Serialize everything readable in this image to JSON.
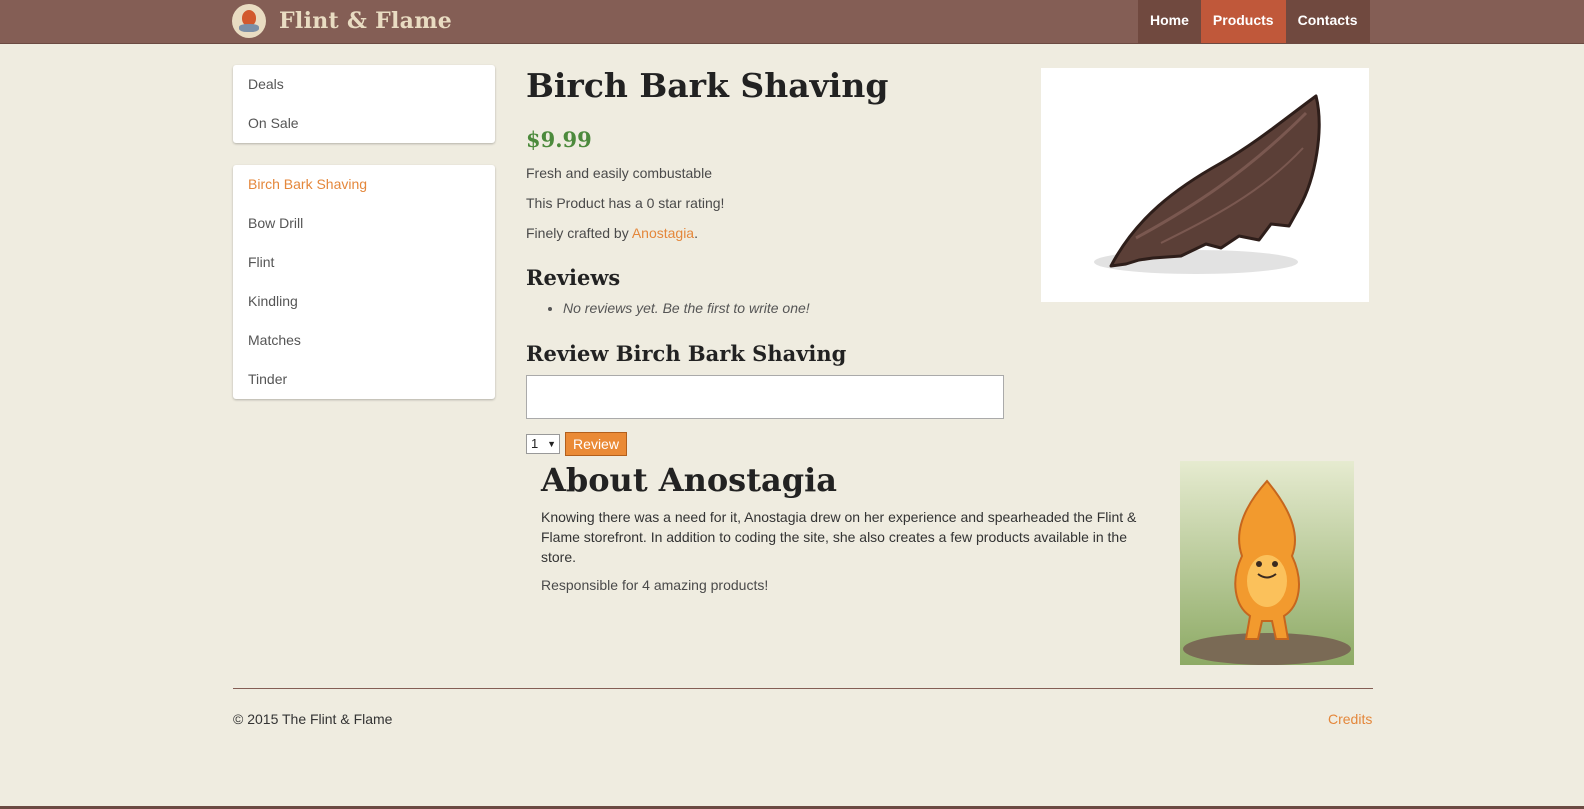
{
  "header": {
    "brand": "Flint & Flame",
    "logo_icon": "flame-logo-icon",
    "nav": [
      {
        "label": "Home",
        "active": false
      },
      {
        "label": "Products",
        "active": true
      },
      {
        "label": "Contacts",
        "active": false
      }
    ]
  },
  "sidebar": {
    "top_items": [
      {
        "label": "Deals"
      },
      {
        "label": "On Sale"
      }
    ],
    "product_items": [
      {
        "label": "Birch Bark Shaving",
        "active": true
      },
      {
        "label": "Bow Drill",
        "active": false
      },
      {
        "label": "Flint",
        "active": false
      },
      {
        "label": "Kindling",
        "active": false
      },
      {
        "label": "Matches",
        "active": false
      },
      {
        "label": "Tinder",
        "active": false
      }
    ]
  },
  "product": {
    "title": "Birch Bark Shaving",
    "price": "$9.99",
    "description": "Fresh and easily combustable",
    "rating_text": "This Product has a 0 star rating!",
    "crafted_prefix": "Finely crafted by ",
    "crafted_author": "Anostagia",
    "crafted_suffix": ".",
    "image_icon": "birch-bark-shaving-image"
  },
  "reviews": {
    "heading": "Reviews",
    "items": [
      "No reviews yet. Be the first to write one!"
    ],
    "form_heading": "Review Birch Bark Shaving",
    "rating_value": "1",
    "submit_label": "Review"
  },
  "author": {
    "heading": "About Anostagia",
    "bio": "Knowing there was a need for it, Anostagia drew on her experience and spearheaded the Flint & Flame storefront. In addition to coding the site, she also creates a few products available in the store.",
    "products_text": "Responsible for 4 amazing products!",
    "image_icon": "author-flame-character-image"
  },
  "footer": {
    "copyright": "© 2015 The Flint & Flame",
    "credits": "Credits"
  },
  "colors": {
    "header_bg": "#845e55",
    "accent": "#e4873b",
    "nav_active": "#c0583a",
    "price": "#4c8a3c",
    "page_bg": "#efece0"
  }
}
